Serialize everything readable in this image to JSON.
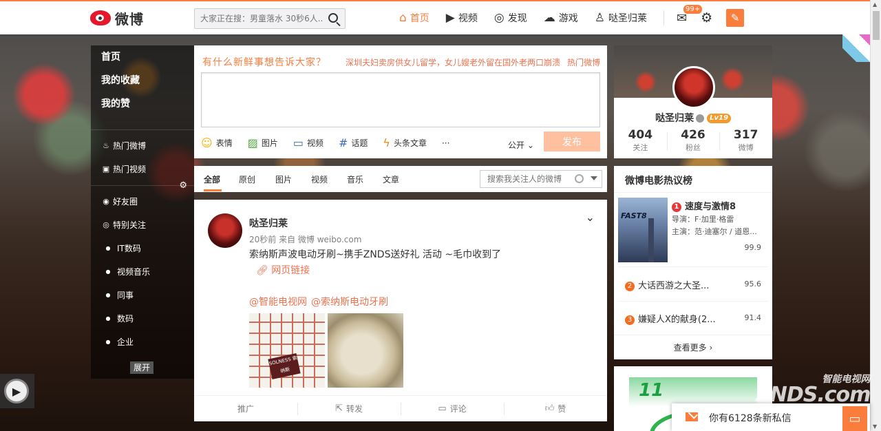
{
  "header": {
    "logo_text": "微博",
    "search_placeholder": "大家正在搜：男童落水 30秒6人...",
    "nav": [
      {
        "label": "首页",
        "icon": "home-icon"
      },
      {
        "label": "视频",
        "icon": "video-icon"
      },
      {
        "label": "发现",
        "icon": "compass-icon"
      },
      {
        "label": "游戏",
        "icon": "gamepad-icon"
      },
      {
        "label": "哒圣归莱",
        "icon": "user-icon"
      }
    ],
    "mail_badge": "99+"
  },
  "sidebar": {
    "top_items": [
      "首页",
      "我的收藏",
      "我的赞"
    ],
    "hot_items": [
      "热门微博",
      "热门视频"
    ],
    "group_items": [
      "好友圈",
      "特别关注"
    ],
    "sub_items": [
      "IT数码",
      "视频音乐",
      "同事",
      "数码",
      "企业"
    ],
    "expand_label": "展开"
  },
  "composer": {
    "title": "有什么新鲜事想告诉大家？",
    "hot_text": "深圳夫妇卖房供女儿留学，女儿嫂老外留在国外老两口崩溃",
    "hot_link": "热门微博",
    "tools": [
      "表情",
      "图片",
      "视频",
      "话题",
      "头条文章"
    ],
    "more": "···",
    "visibility": "公开",
    "send_label": "发布"
  },
  "feed_tabs": {
    "tabs": [
      "全部",
      "原创",
      "图片",
      "视频",
      "音乐",
      "文章"
    ],
    "search_placeholder": "搜索我关注人的微博"
  },
  "post": {
    "author": "哒圣归莱",
    "meta": "20秒前 来自 微博 weibo.com",
    "text": "索纳斯声波电动牙刷~携手ZNDS送好礼 活动 ~毛巾收到了",
    "link": "网页链接",
    "mentions": [
      "@智能电视网",
      "@索纳斯电动牙刷"
    ],
    "thumb_brand": "SOLNESS 索纳斯",
    "actions": [
      "推广",
      "转发",
      "评论",
      "赞"
    ]
  },
  "profile": {
    "name": "哒圣归莱",
    "level": "Lv19",
    "stats": [
      {
        "value": "404",
        "label": "关注"
      },
      {
        "value": "426",
        "label": "粉丝"
      },
      {
        "value": "317",
        "label": "微博"
      }
    ]
  },
  "movies": {
    "title": "微博电影热议榜",
    "poster_text": "FAST8",
    "top": {
      "rank": "1",
      "name": "速度与激情8",
      "director": "导演：F·加里·格雷",
      "cast": "主演：范·迪塞尔 / 道恩...",
      "score": "99.9"
    },
    "rest": [
      {
        "rank": "2",
        "name": "大话西游之大圣...",
        "score": "95.6"
      },
      {
        "rank": "3",
        "name": "嫌疑人X的献身(2...",
        "score": "91.4"
      }
    ],
    "more_label": "查看更多"
  },
  "watermark": {
    "line1": "智能电视网",
    "line2": "ZNDS.com"
  },
  "toast": {
    "text": "你有6128条新私信"
  }
}
